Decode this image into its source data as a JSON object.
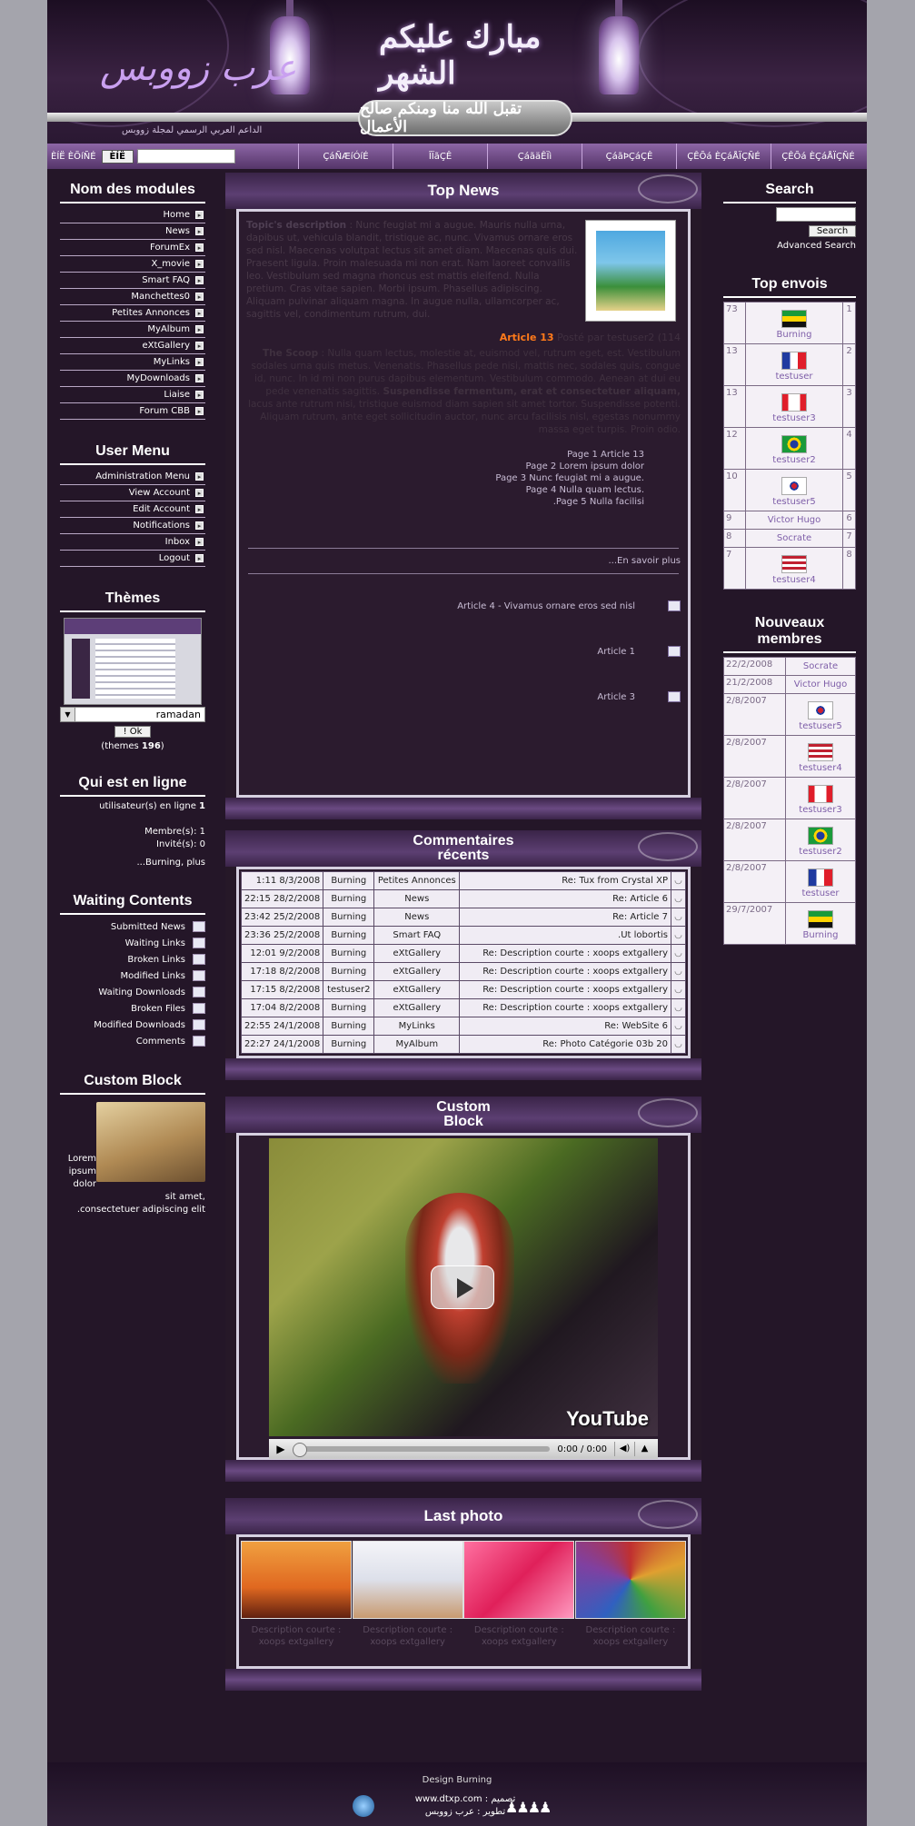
{
  "header": {
    "logo": "عرب زووبس",
    "calligraphy": "مبارك عليكم الشهر",
    "plaque": "تقبل الله منا ومنكم صالح الأعمال",
    "tagline": "الداعم العربي الرسمي لمجلة زووبس"
  },
  "nav": {
    "search_label": "ÈÍË ÈÕíÑÉ",
    "search_btn": "ÈÍË",
    "tabs": [
      "ÇáÑÆíÓíÉ",
      "ÎÏãÇÊ",
      "ÇáãäÊÏì",
      "ÇáãÞÇáÇÊ",
      "ÇÊÕá ÈÇáÅÏÇÑÉ",
      "ÇÊÕá ÈÇáÅÏÇÑÉ"
    ]
  },
  "modules": {
    "title": "Nom des modules",
    "items": [
      "Home",
      "News",
      "ForumEx",
      "X_movie",
      "Smart FAQ",
      "Manchettes0",
      "Petites Annonces",
      "MyAlbum",
      "eXtGallery",
      "MyLinks",
      "MyDownloads",
      "Liaise",
      "Forum CBB"
    ]
  },
  "usermenu": {
    "title": "User Menu",
    "items": [
      "Administration Menu",
      "View Account",
      "Edit Account",
      "Notifications",
      "Inbox",
      "Logout"
    ]
  },
  "themes": {
    "title": "Thèmes",
    "selected": "ramadan",
    "ok": "! Ok",
    "count_prefix": "(themes ",
    "count": "196",
    "count_suffix": ")"
  },
  "online": {
    "title": "Qui est en ligne",
    "line1": "utilisateur(s) en ligne ",
    "line1_num": "1",
    "members": "Membre(s): 1",
    "guests": "Invité(s): 0",
    "who": "...Burning, plus"
  },
  "waiting": {
    "title": "Waiting Contents",
    "items": [
      "Submitted News",
      "Waiting Links",
      "Broken Links",
      "Modified Links",
      "Waiting Downloads",
      "Broken Files",
      "Modified Downloads",
      "Comments"
    ]
  },
  "custom": {
    "title": "Custom Block",
    "text1": "Lorem",
    "text2": "ipsum dolor sit amet,",
    "text3": ".consectetuer adipiscing elit"
  },
  "topnews": {
    "title": "Top News",
    "desc_label": "Topic's description",
    "desc_text": ": Nunc feugiat mi a augue. Mauris nulla urna, dapibus ut, vehicula blandit, tristique ac, nunc. Vivamus ornare eros sed nisl. Maecenas volutpat lectus sit amet diam. Maecenas quis dui. Praesent ligula. Proin malesuada mi non erat. Nam laoreet convallis leo. Vestibulum sed magna rhoncus est mattis eleifend. Nulla pretium. Cras vitae sapien. Morbi ipsum. Phasellus adipiscing. Aliquam pulvinar aliquam magna. In augue nulla, ullamcorper ac, sagittis vel, condimentum rutrum, dui.",
    "article_title": "Article 13",
    "article_by": " Posté par testuser2 (114",
    "scoop_label": "The Scoop",
    "scoop_text": ": Nulla quam lectus, molestie at, euismod vel, rutrum eget, est. Vestibulum sodales urna quis metus. Venenatis. Phasellus pede nisi, mattis nec, sodales quis, congue id, nunc. In id mi non purus dapibus elementum. Vestibulum commodo. Aenean at dui eu pede venenatis sagittis.",
    "scoop_bold": "Suspendisse fermentum, erat et consectetuer aliquam,",
    "scoop_tail": "lacus ante rutrum nisi, tristique euismod diam sapien sit amet tortor. Suspendisse potenti. Aliquam rutrum, ante eget sollicitudin auctor, nunc arcu facilisis nisl, egestas nonummy massa eget turpis. Proin odio.",
    "pages": [
      "Page 1 Article 13",
      "Page 2 Lorem ipsum dolor",
      "Page 3 Nunc feugiat mi a augue.",
      "Page 4 Nulla quam lectus.",
      ".Page 5 Nulla facilisi"
    ],
    "more": "...En savoir plus",
    "others": [
      "Article 4 - Vivamus ornare eros sed nisl",
      "Article 1",
      "Article 3"
    ]
  },
  "comments": {
    "title": "Commentaires récents",
    "rows": [
      {
        "time": "1:11 8/3/2008",
        "user": "Burning",
        "module": "Petites Annonces",
        "title": "Re: Tux from Crystal XP"
      },
      {
        "time": "22:15 28/2/2008",
        "user": "Burning",
        "module": "News",
        "title": "Re: Article 6"
      },
      {
        "time": "23:42 25/2/2008",
        "user": "Burning",
        "module": "News",
        "title": "Re: Article 7"
      },
      {
        "time": "23:36 25/2/2008",
        "user": "Burning",
        "module": "Smart FAQ",
        "title": ".Ut lobortis"
      },
      {
        "time": "12:01 9/2/2008",
        "user": "Burning",
        "module": "eXtGallery",
        "title": "Re: Description courte : xoops extgallery"
      },
      {
        "time": "17:18 8/2/2008",
        "user": "Burning",
        "module": "eXtGallery",
        "title": "Re: Description courte : xoops extgallery"
      },
      {
        "time": "17:15 8/2/2008",
        "user": "testuser2",
        "module": "eXtGallery",
        "title": "Re: Description courte : xoops extgallery"
      },
      {
        "time": "17:04 8/2/2008",
        "user": "Burning",
        "module": "eXtGallery",
        "title": "Re: Description courte : xoops extgallery"
      },
      {
        "time": "22:55 24/1/2008",
        "user": "Burning",
        "module": "MyLinks",
        "title": "Re: WebSite 6"
      },
      {
        "time": "22:27 24/1/2008",
        "user": "Burning",
        "module": "MyAlbum",
        "title": "Re: Photo Catégorie 03b 20"
      }
    ]
  },
  "customblock": {
    "title": "Custom Block",
    "yt": "YouTube",
    "time": "0:00 / 0:00"
  },
  "lastphoto": {
    "title": "Last photo",
    "items": [
      {
        "cap1": "Description courte :",
        "cap2": "xoops extgallery",
        "grad": "linear-gradient(180deg,#f0a040 0%,#e06820 60%,#602010 100%)"
      },
      {
        "cap1": "Description courte :",
        "cap2": "xoops extgallery",
        "grad": "linear-gradient(180deg,#f4f4f8 0%,#dde0ea 50%,#c89a70 100%)"
      },
      {
        "cap1": "Description courte :",
        "cap2": "xoops extgallery",
        "grad": "linear-gradient(135deg,#ff70a0 0%,#e0205a 50%,#ff9ac0 100%)"
      },
      {
        "cap1": "Description courte :",
        "cap2": "xoops extgallery",
        "grad": "conic-gradient(#c03030,#e0a030,#40a040,#3060c0,#8040a0,#c03030)"
      }
    ]
  },
  "rsearch": {
    "title": "Search",
    "btn": "Search",
    "adv": "Advanced Search"
  },
  "topenvois": {
    "title": "Top envois",
    "rows": [
      {
        "n": "73",
        "u": "Burning",
        "r": "1",
        "flag": "linear-gradient(#1a9a3a 0 33%,#ffd400 33% 66%,#111 66%)"
      },
      {
        "n": "13",
        "u": "testuser",
        "r": "2",
        "flag": "linear-gradient(90deg,#1f3aa0 0 33%,#fff 33% 66%,#e01e2a 66%)"
      },
      {
        "n": "13",
        "u": "testuser3",
        "r": "3",
        "flag": "linear-gradient(90deg,#e01e2a 0 25%,#fff 25% 75%,#e01e2a 75%)"
      },
      {
        "n": "12",
        "u": "testuser2",
        "r": "4",
        "flag": "radial-gradient(circle,#1f3aa0 0 28%,#ffd400 29% 46%,#1a9a3a 47%)"
      },
      {
        "n": "10",
        "u": "testuser5",
        "r": "5",
        "flag": "radial-gradient(circle,#d02030 0 18%,#1f3aa0 19% 30%,#fff 31%)"
      },
      {
        "n": "9",
        "u": "Victor Hugo",
        "r": "6",
        "flag": ""
      },
      {
        "n": "8",
        "u": "Socrate",
        "r": "7",
        "flag": ""
      },
      {
        "n": "7",
        "u": "testuser4",
        "r": "8",
        "flag": "repeating-linear-gradient(#c02030 0 3px,#fff 3px 6px)"
      }
    ]
  },
  "nouveaux": {
    "title": "Nouveaux membres",
    "rows": [
      {
        "d": "22/2/2008",
        "u": "Socrate",
        "flag": ""
      },
      {
        "d": "21/2/2008",
        "u": "Victor Hugo",
        "flag": ""
      },
      {
        "d": "2/8/2007",
        "u": "testuser5",
        "flag": "radial-gradient(circle,#d02030 0 18%,#1f3aa0 19% 30%,#fff 31%)"
      },
      {
        "d": "2/8/2007",
        "u": "testuser4",
        "flag": "repeating-linear-gradient(#c02030 0 3px,#fff 3px 6px)"
      },
      {
        "d": "2/8/2007",
        "u": "testuser3",
        "flag": "linear-gradient(90deg,#e01e2a 0 25%,#fff 25% 75%,#e01e2a 75%)"
      },
      {
        "d": "2/8/2007",
        "u": "testuser2",
        "flag": "radial-gradient(circle,#1f3aa0 0 28%,#ffd400 29% 46%,#1a9a3a 47%)"
      },
      {
        "d": "2/8/2007",
        "u": "testuser",
        "flag": "linear-gradient(90deg,#1f3aa0 0 33%,#fff 33% 66%,#e01e2a 66%)"
      },
      {
        "d": "29/7/2007",
        "u": "Burning",
        "flag": "linear-gradient(#1a9a3a 0 33%,#ffd400 33% 66%,#111 66%)"
      }
    ]
  },
  "footer": {
    "design": "Design Burning",
    "l1": "www.dtxp.com : تصميم",
    "l2": "تطوير : عرب زووبس"
  }
}
